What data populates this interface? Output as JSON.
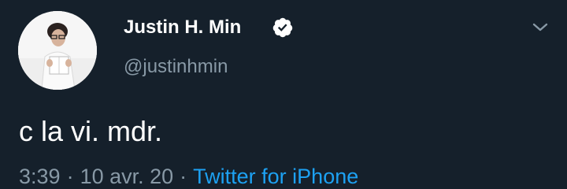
{
  "user": {
    "display_name": "Justin H. Min",
    "handle": "@justinhmin",
    "verified": true,
    "avatar_icon": "profile-photo"
  },
  "tweet": {
    "text": "c la vi. mdr.",
    "time": "3:39",
    "separator": "·",
    "date": "10 avr. 20",
    "source": "Twitter for iPhone"
  },
  "colors": {
    "background": "#15202b",
    "text_primary": "#ffffff",
    "text_secondary": "#8899a6",
    "link": "#1da1f2"
  },
  "icons": {
    "verified": "verified-badge-icon",
    "menu": "chevron-down-icon"
  }
}
